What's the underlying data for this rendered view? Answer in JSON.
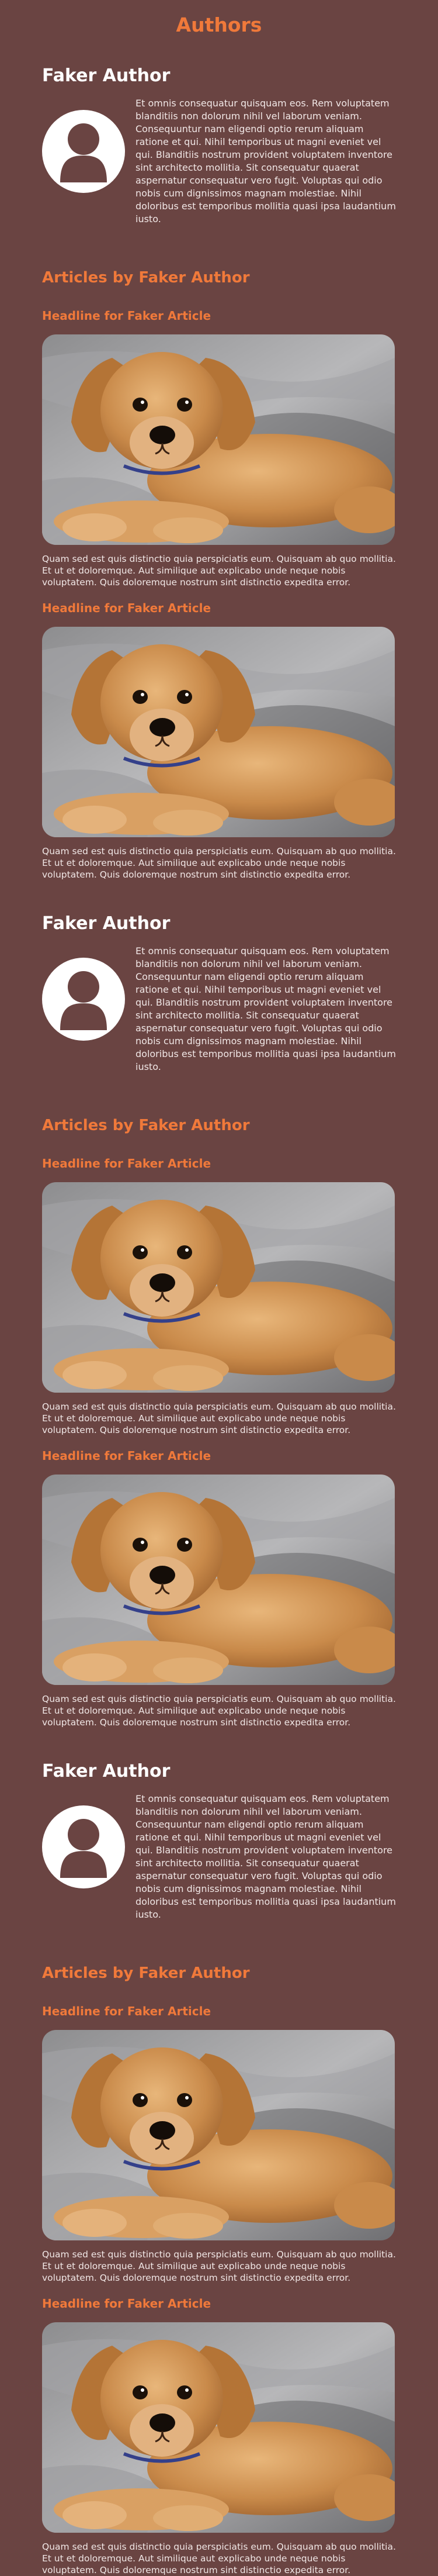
{
  "page": {
    "title": "Authors"
  },
  "authors": [
    {
      "name": "Faker Author",
      "bio": "Et omnis consequatur quisquam eos. Rem voluptatem blanditiis non dolorum nihil vel laborum veniam. Consequuntur nam eligendi optio rerum aliquam ratione et qui. Nihil temporibus ut magni eveniet vel qui. Blanditiis nostrum provident voluptatem inventore sint architecto mollitia. Sit consequatur quaerat aspernatur consequatur vero fugit. Voluptas qui odio nobis cum dignissimos magnam molestiae. Nihil doloribus est temporibus mollitia quasi ipsa laudantium iusto.",
      "articles_heading": "Articles by Faker Author",
      "articles": [
        {
          "headline": "Headline for Faker Article",
          "image": "puppy-photo",
          "text": "Quam sed est quis distinctio quia perspiciatis eum. Quisquam ab quo mollitia. Et ut et doloremque. Aut similique aut explicabo unde neque nobis voluptatem. Quis doloremque nostrum sint distinctio expedita error."
        },
        {
          "headline": "Headline for Faker Article",
          "image": "puppy-photo",
          "text": "Quam sed est quis distinctio quia perspiciatis eum. Quisquam ab quo mollitia. Et ut et doloremque. Aut similique aut explicabo unde neque nobis voluptatem. Quis doloremque nostrum sint distinctio expedita error."
        }
      ]
    },
    {
      "name": "Faker Author",
      "bio": "Et omnis consequatur quisquam eos. Rem voluptatem blanditiis non dolorum nihil vel laborum veniam. Consequuntur nam eligendi optio rerum aliquam ratione et qui. Nihil temporibus ut magni eveniet vel qui. Blanditiis nostrum provident voluptatem inventore sint architecto mollitia. Sit consequatur quaerat aspernatur consequatur vero fugit. Voluptas qui odio nobis cum dignissimos magnam molestiae. Nihil doloribus est temporibus mollitia quasi ipsa laudantium iusto.",
      "articles_heading": "Articles by Faker Author",
      "articles": [
        {
          "headline": "Headline for Faker Article",
          "image": "puppy-photo",
          "text": "Quam sed est quis distinctio quia perspiciatis eum. Quisquam ab quo mollitia. Et ut et doloremque. Aut similique aut explicabo unde neque nobis voluptatem. Quis doloremque nostrum sint distinctio expedita error."
        },
        {
          "headline": "Headline for Faker Article",
          "image": "puppy-photo",
          "text": "Quam sed est quis distinctio quia perspiciatis eum. Quisquam ab quo mollitia. Et ut et doloremque. Aut similique aut explicabo unde neque nobis voluptatem. Quis doloremque nostrum sint distinctio expedita error."
        }
      ]
    },
    {
      "name": "Faker Author",
      "bio": "Et omnis consequatur quisquam eos. Rem voluptatem blanditiis non dolorum nihil vel laborum veniam. Consequuntur nam eligendi optio rerum aliquam ratione et qui. Nihil temporibus ut magni eveniet vel qui. Blanditiis nostrum provident voluptatem inventore sint architecto mollitia. Sit consequatur quaerat aspernatur consequatur vero fugit. Voluptas qui odio nobis cum dignissimos magnam molestiae. Nihil doloribus est temporibus mollitia quasi ipsa laudantium iusto.",
      "articles_heading": "Articles by Faker Author",
      "articles": [
        {
          "headline": "Headline for Faker Article",
          "image": "puppy-photo",
          "text": "Quam sed est quis distinctio quia perspiciatis eum. Quisquam ab quo mollitia. Et ut et doloremque. Aut similique aut explicabo unde neque nobis voluptatem. Quis doloremque nostrum sint distinctio expedita error."
        },
        {
          "headline": "Headline for Faker Article",
          "image": "puppy-photo",
          "text": "Quam sed est quis distinctio quia perspiciatis eum. Quisquam ab quo mollitia. Et ut et doloremque. Aut similique aut explicabo unde neque nobis voluptatem. Quis doloremque nostrum sint distinctio expedita error."
        }
      ]
    }
  ],
  "colors": {
    "background": "#6a4442",
    "accent": "#f0793a",
    "text": "#ffffff",
    "avatar": "#ffffff",
    "avatar_silhouette": "#6a4442"
  },
  "icons": {
    "avatar": "user-silhouette-icon"
  }
}
